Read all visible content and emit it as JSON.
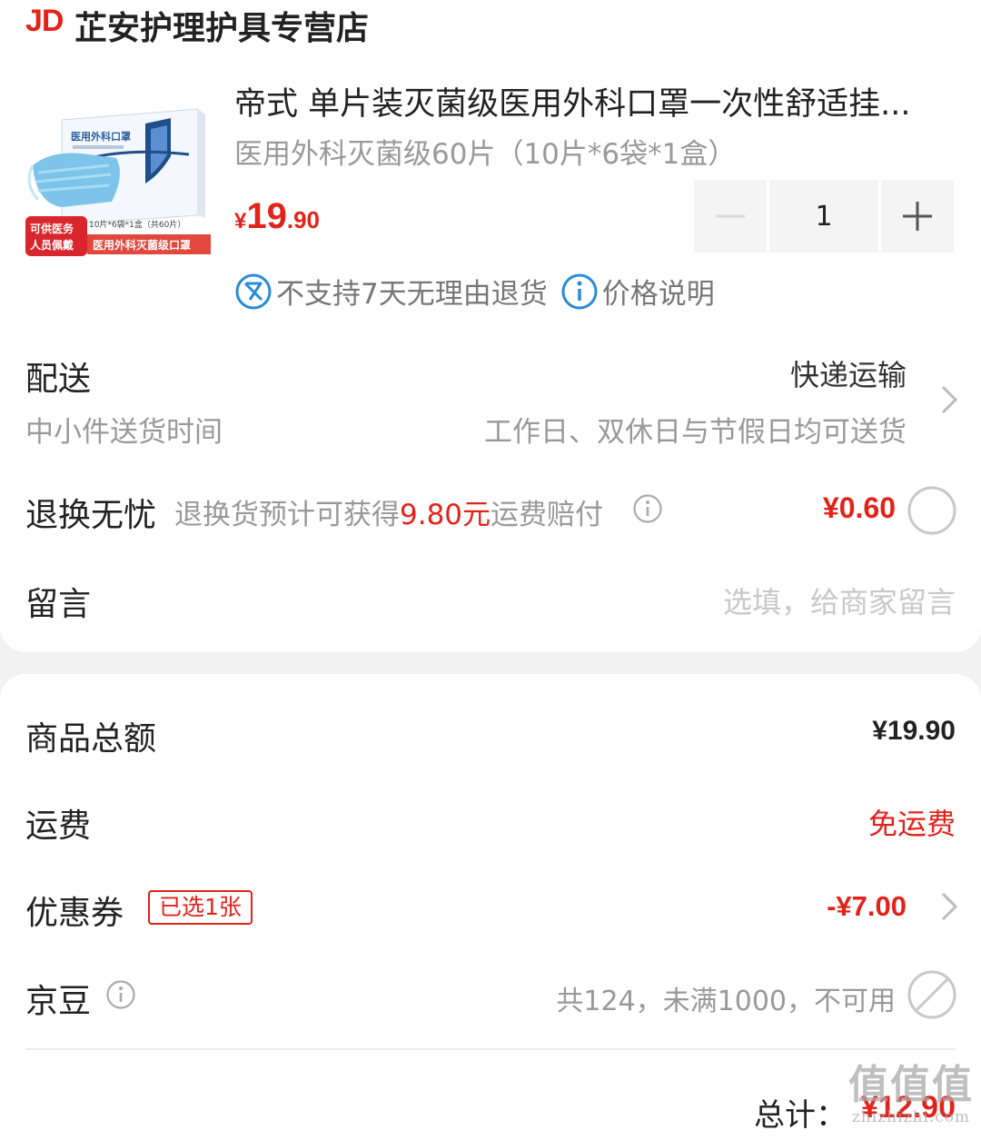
{
  "store": {
    "logo": "JD",
    "name": "芷安护理护具专营店"
  },
  "product": {
    "title": "帝式 单片装灭菌级医用外科口罩一次性舒适挂...",
    "spec": "医用外科灭菌级60片（10片*6袋*1盒）",
    "price_currency": "¥",
    "price_int": "19",
    "price_dec": ".90",
    "quantity": "1",
    "image_text": {
      "box_title": "医用外科口罩",
      "pack_info": "10片*6袋*1盒（共60片）",
      "badge_line1": "可供医务",
      "badge_line2": "人员佩戴",
      "banner": "医用外科灭菌级口罩"
    }
  },
  "tags": {
    "no_return": "不支持7天无理由退货",
    "price_note": "价格说明"
  },
  "delivery": {
    "label": "配送",
    "method": "快递运输",
    "time_label": "中小件送货时间",
    "time_value": "工作日、双休日与节假日均可送货"
  },
  "return_insurance": {
    "label": "退换无忧",
    "desc_pre": "退换货预计可获得",
    "desc_amount": "9.80元",
    "desc_post": "运费赔付",
    "price": "¥0.60"
  },
  "message": {
    "label": "留言",
    "placeholder": "选填，给商家留言"
  },
  "summary": {
    "goods_total_label": "商品总额",
    "goods_total_value": "¥19.90",
    "shipping_label": "运费",
    "shipping_value": "免运费",
    "coupon_label": "优惠券",
    "coupon_badge": "已选1张",
    "coupon_value": "-¥7.00",
    "jingdou_label": "京豆",
    "jingdou_value": "共124，未满1000，不可用",
    "total_label": "总计：",
    "total_value": "¥12.90"
  },
  "watermark": {
    "big": "值值值",
    "small": "zhizhizhi.com"
  },
  "colors": {
    "accent": "#e2231a",
    "info_blue": "#2a8bd8",
    "grey_text": "#999999"
  }
}
